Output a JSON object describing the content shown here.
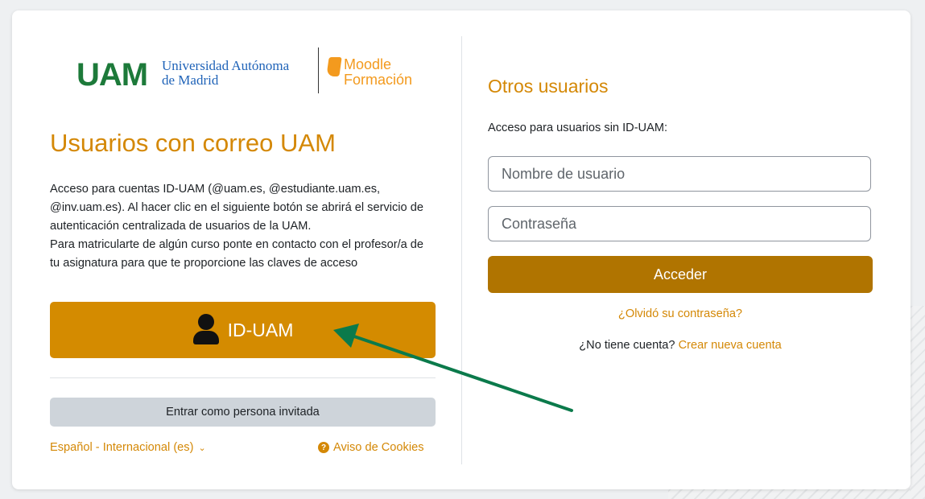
{
  "logo": {
    "uam_mark": "UAM",
    "university_name_line1": "Universidad Autónoma",
    "university_name_line2": "de Madrid",
    "moodle_line1": "Moodle",
    "moodle_line2": "Formación"
  },
  "left": {
    "title": "Usuarios con correo UAM",
    "description_p1": "Acceso para cuentas ID-UAM (@uam.es, @estudiante.uam.es, @inv.uam.es). Al hacer clic en el siguiente botón se abrirá el servicio de autenticación centralizada de usuarios de la UAM.",
    "description_p2": "Para matricularte de algún curso ponte en contacto con el profesor/a de tu asignatura para que te proporcione las claves de acceso",
    "sso_button_label": "ID-UAM",
    "guest_button_label": "Entrar como persona invitada",
    "language_label": "Español - Internacional (es)",
    "cookies_label": "Aviso de Cookies"
  },
  "right": {
    "title": "Otros usuarios",
    "subtitle": "Acceso para usuarios sin ID-UAM:",
    "username_placeholder": "Nombre de usuario",
    "password_placeholder": "Contraseña",
    "login_button_label": "Acceder",
    "forgot_password_label": "¿Olvidó su contraseña?",
    "no_account_text": "¿No tiene cuenta?",
    "create_account_label": "Crear nueva cuenta"
  },
  "colors": {
    "accent": "#d48806",
    "sso_button": "#d48b00",
    "login_button": "#b07400",
    "guest_button": "#ced4da",
    "annotation_arrow": "#0b7a4b"
  },
  "icons": [
    "user-icon",
    "chevron-down-icon",
    "question-circle-icon",
    "arrow-annotation"
  ]
}
